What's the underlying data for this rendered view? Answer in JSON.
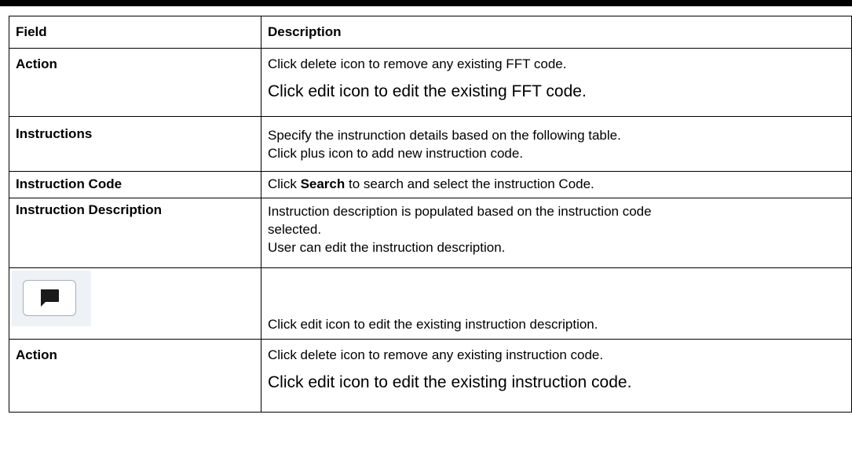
{
  "table": {
    "headers": {
      "field": "Field",
      "description": "Description"
    },
    "rows": [
      {
        "field": "Action",
        "lines": [
          "Click delete icon to remove any existing FFT code.",
          "Click edit icon to edit the existing FFT code."
        ]
      },
      {
        "field": "Instructions",
        "lines": [
          "Specify the instrunction details based on the following table.",
          "Click plus icon to add new instruction code."
        ]
      },
      {
        "field": "Instruction Code",
        "pre": "Click ",
        "bold": "Search",
        "post": " to search and select the instruction Code."
      },
      {
        "field": "Instruction Description",
        "lines": [
          "Instruction description is populated based on the instruction code",
          "selected.",
          "User can edit the instruction description."
        ]
      },
      {
        "icon": "comment-edit-icon",
        "lines": [
          "Click edit icon to edit the existing instruction description."
        ]
      },
      {
        "field": "Action",
        "lines": [
          "Click delete icon to remove any existing instruction code.",
          "Click edit icon to edit the existing instruction code."
        ]
      }
    ]
  }
}
